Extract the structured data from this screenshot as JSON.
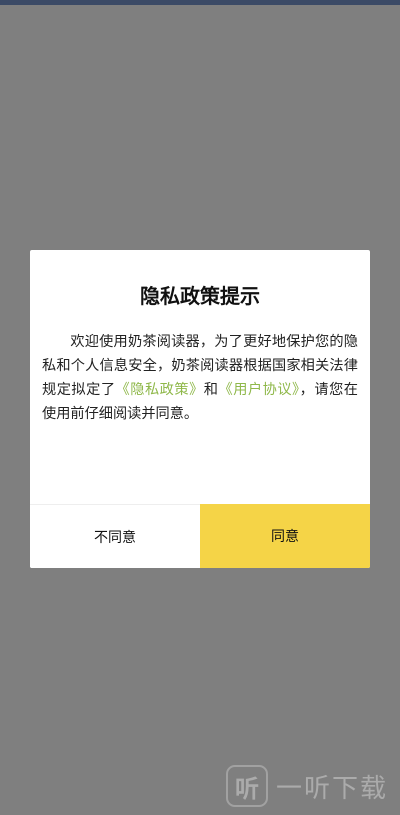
{
  "dialog": {
    "title": "隐私政策提示",
    "body_text_1": "欢迎使用奶茶阅读器，为了更好地保护您的隐私和个人信息安全，奶茶阅读器根据国家相关法律规定拟定了",
    "privacy_link": "《隐私政策》",
    "body_text_2": "和",
    "user_agreement_link": "《用户协议》",
    "body_text_3": "，请您在使用前仔细阅读并同意。",
    "disagree_label": "不同意",
    "agree_label": "同意"
  },
  "watermark": {
    "logo_glyph": "听",
    "text": "一听下载"
  },
  "colors": {
    "link": "#8fb84a",
    "agree_button": "#f5d447",
    "overlay": "#787878"
  }
}
